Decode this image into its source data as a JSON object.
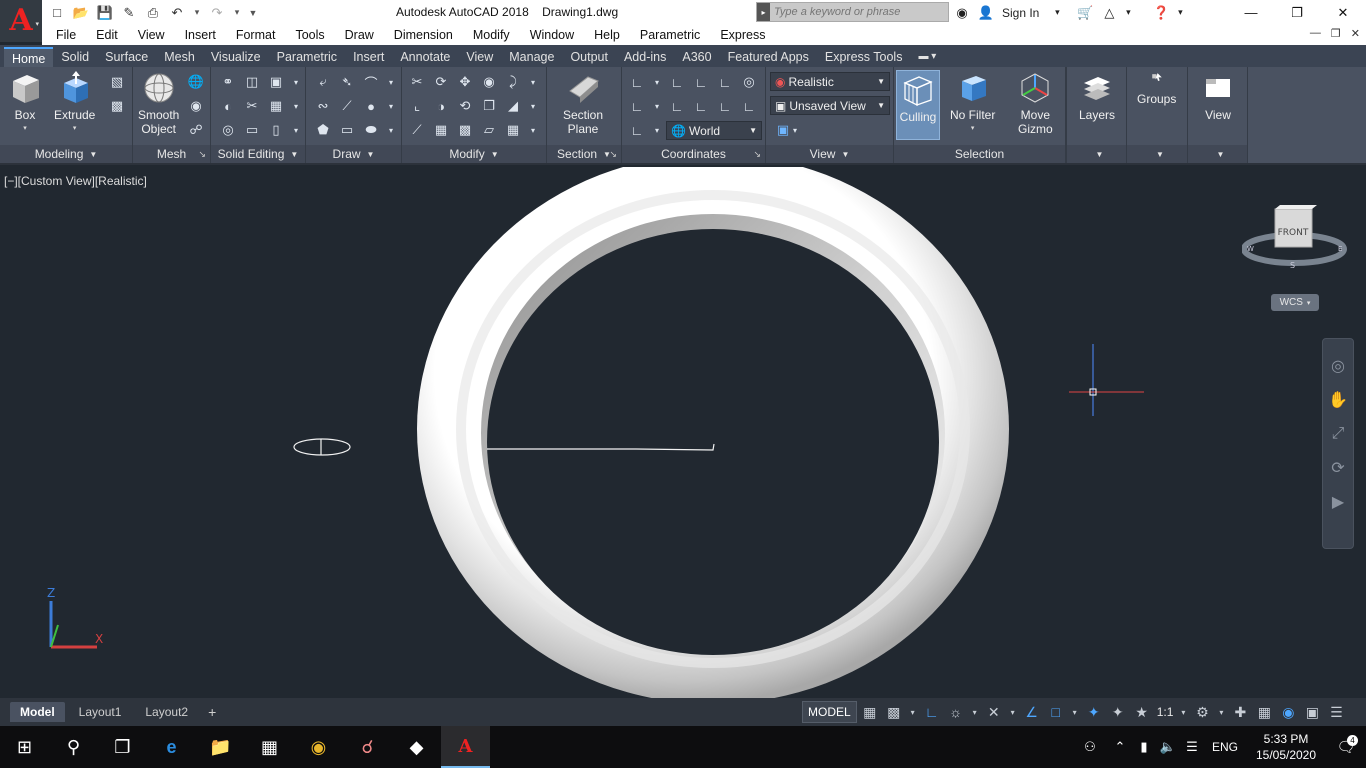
{
  "titlebar": {
    "app_name": "Autodesk AutoCAD 2018",
    "document": "Drawing1.dwg",
    "search_placeholder": "Type a keyword or phrase",
    "signin": "Sign In"
  },
  "menubar": [
    "File",
    "Edit",
    "View",
    "Insert",
    "Format",
    "Tools",
    "Draw",
    "Dimension",
    "Modify",
    "Window",
    "Help",
    "Parametric",
    "Express"
  ],
  "ribbon_tabs": [
    "Home",
    "Solid",
    "Surface",
    "Mesh",
    "Visualize",
    "Parametric",
    "Insert",
    "Annotate",
    "View",
    "Manage",
    "Output",
    "Add-ins",
    "A360",
    "Featured Apps",
    "Express Tools"
  ],
  "ribbon": {
    "modeling": {
      "title": "Modeling",
      "box": "Box",
      "extrude": "Extrude"
    },
    "mesh": {
      "title": "Mesh",
      "smooth_1": "Smooth",
      "smooth_2": "Object"
    },
    "solid_editing": {
      "title": "Solid Editing"
    },
    "draw": {
      "title": "Draw"
    },
    "modify": {
      "title": "Modify"
    },
    "section": {
      "title": "Section",
      "btn_1": "Section",
      "btn_2": "Plane"
    },
    "coordinates": {
      "title": "Coordinates",
      "ucs_value": "World"
    },
    "view": {
      "title": "View",
      "visual_style": "Realistic",
      "named_view": "Unsaved View"
    },
    "selection": {
      "title": "Selection",
      "culling": "Culling",
      "nofilter": "No Filter",
      "gizmo_1": "Move",
      "gizmo_2": "Gizmo"
    },
    "layers": {
      "label": "Layers"
    },
    "groups": {
      "label": "Groups"
    },
    "viewpanel": {
      "label": "View"
    }
  },
  "viewport": {
    "view_label": "[−][Custom View][Realistic]",
    "viewcube_face": "FRONT",
    "compass": {
      "w": "W",
      "e": "E",
      "s": "S"
    },
    "wcs": "WCS",
    "ucs_axes": {
      "z": "Z",
      "x": "X"
    }
  },
  "layout_tabs": [
    "Model",
    "Layout1",
    "Layout2"
  ],
  "layout_add": "+",
  "statusbar": {
    "model": "MODEL",
    "scale": "1:1"
  },
  "taskbar": {
    "lang": "ENG",
    "time": "5:33 PM",
    "date": "15/05/2020",
    "notifications": "4"
  },
  "colors": {
    "background": "#212830",
    "ribbon": "#4a5261",
    "accent": "#4ea7ff",
    "autocad_red": "#e22222"
  }
}
